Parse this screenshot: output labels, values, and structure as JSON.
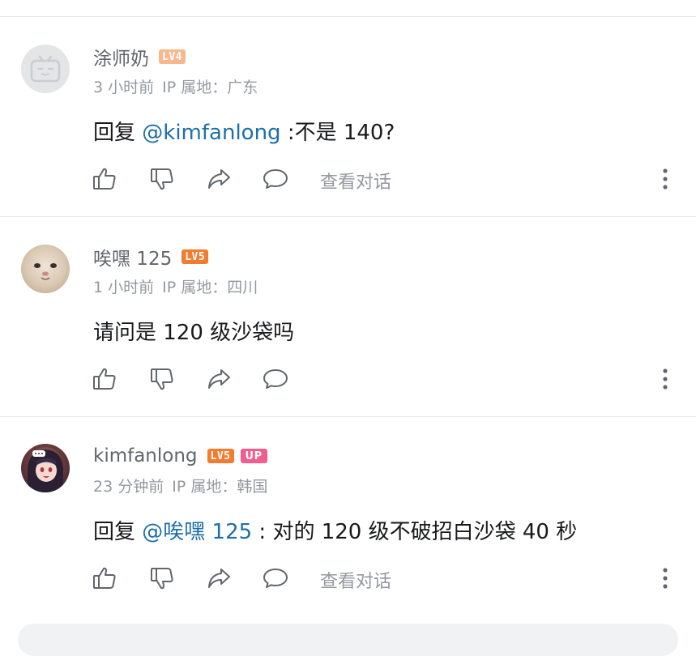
{
  "comments": [
    {
      "username": "涂师奶",
      "level": "LV4",
      "level_color": "#f6b98f",
      "up_badge": null,
      "avatar": "default-tv-avatar",
      "time": "3 小时前",
      "ip": "IP 属地：广东",
      "reply_prefix": "回复 ",
      "mention": "@kimfanlong",
      "text": " :不是 140?",
      "view_conversation": "查看对话"
    },
    {
      "username": "唉嘿 125",
      "level": "LV5",
      "level_color": "#f47c2f",
      "up_badge": null,
      "avatar": "cat-photo-avatar",
      "time": "1 小时前",
      "ip": "IP 属地：四川",
      "reply_prefix": "",
      "mention": "",
      "text": "请问是 120 级沙袋吗",
      "view_conversation": ""
    },
    {
      "username": "kimfanlong",
      "level": "LV5",
      "level_color": "#f47c2f",
      "up_badge": "UP",
      "up_color": "#f25d8e",
      "avatar": "anime-avatar",
      "time": "23 分钟前",
      "ip": "IP 属地：韩国",
      "reply_prefix": "回复 ",
      "mention": "@唉嘿 125",
      "text": " : 对的 120 级不破招白沙袋 40 秒",
      "view_conversation": "查看对话"
    }
  ],
  "icons": {
    "like": "thumbs-up-icon",
    "dislike": "thumbs-down-icon",
    "share": "share-arrow-icon",
    "reply": "speech-bubble-icon",
    "more": "vertical-dots-icon"
  },
  "colors": {
    "mention": "#1e6fa7",
    "meta": "#9499a0",
    "icon": "#61666d"
  }
}
